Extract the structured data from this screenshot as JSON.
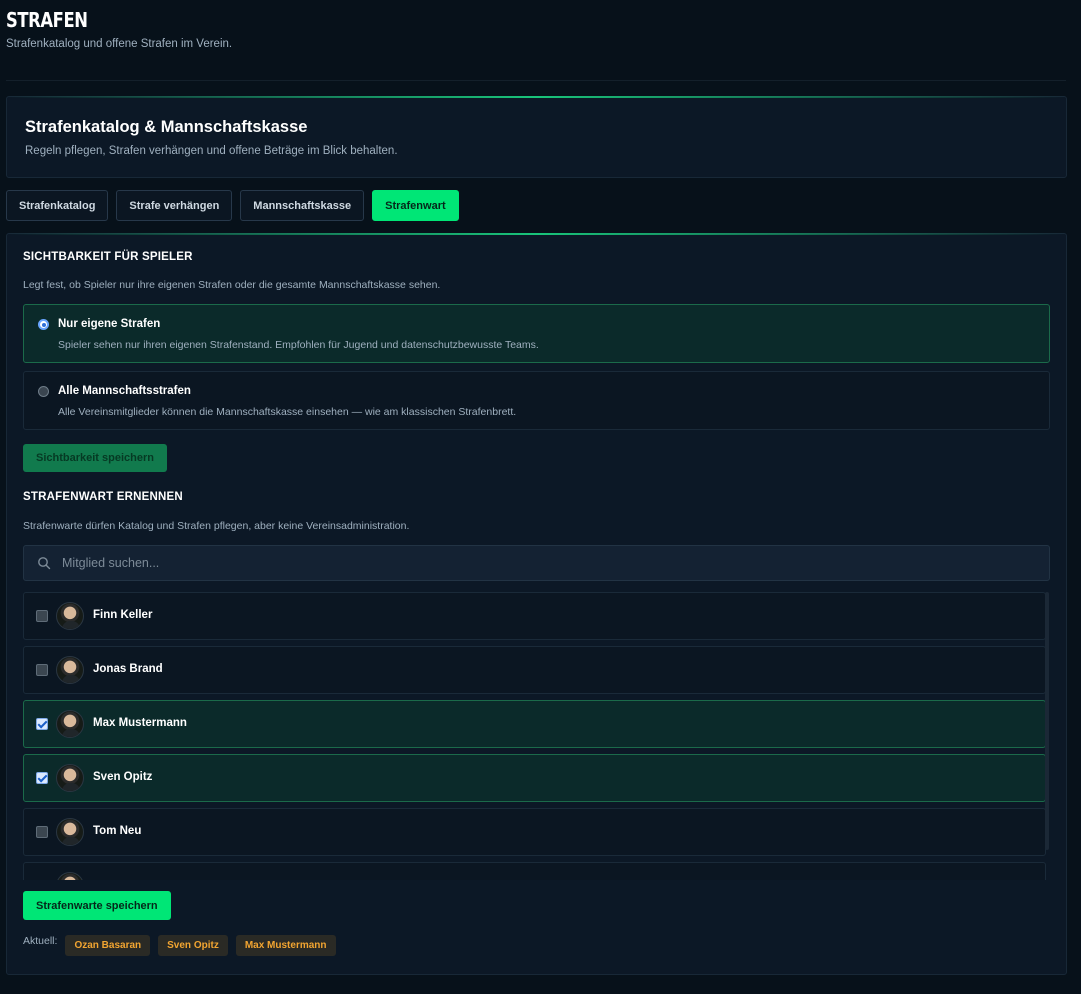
{
  "page": {
    "title": "STRAFEN",
    "subtitle": "Strafenkatalog und offene Strafen im Verein."
  },
  "hero": {
    "title": "Strafenkatalog & Mannschaftskasse",
    "description": "Regeln pflegen, Strafen verhängen und offene Beträge im Blick behalten."
  },
  "tabs": [
    {
      "label": "Strafenkatalog",
      "active": false
    },
    {
      "label": "Strafe verhängen",
      "active": false
    },
    {
      "label": "Mannschaftskasse",
      "active": false
    },
    {
      "label": "Strafenwart",
      "active": true
    }
  ],
  "visibility": {
    "title": "SICHTBARKEIT FÜR SPIELER",
    "description": "Legt fest, ob Spieler nur ihre eigenen Strafen oder die gesamte Mannschaftskasse sehen.",
    "options": [
      {
        "label": "Nur eigene Strafen",
        "description": "Spieler sehen nur ihren eigenen Strafenstand. Empfohlen für Jugend und datenschutzbewusste Teams.",
        "selected": true
      },
      {
        "label": "Alle Mannschaftsstrafen",
        "description": "Alle Vereinsmitglieder können die Mannschaftskasse einsehen — wie am klassischen Strafenbrett.",
        "selected": false
      }
    ],
    "save_label": "Sichtbarkeit speichern"
  },
  "appoint": {
    "title": "STRAFENWART ERNENNEN",
    "description": "Strafenwarte dürfen Katalog und Strafen pflegen, aber keine Vereinsadministration.",
    "search_placeholder": "Mitglied suchen...",
    "members": [
      {
        "name": "Finn Keller",
        "checked": false
      },
      {
        "name": "Jonas Brand",
        "checked": false
      },
      {
        "name": "Max Mustermann",
        "checked": true
      },
      {
        "name": "Sven Opitz",
        "checked": true
      },
      {
        "name": "Tom Neu",
        "checked": false
      },
      {
        "name": "",
        "checked": false
      }
    ],
    "save_label": "Strafenwarte speichern",
    "current_label": "Aktuell:",
    "current": [
      "Ozan Basaran",
      "Sven Opitz",
      "Max Mustermann"
    ]
  },
  "colors": {
    "accent": "#00e676",
    "background": "#07111a",
    "panel": "#0c1826",
    "chip_text": "#f2a531"
  },
  "icons": {
    "search": "search-icon",
    "avatar": "avatar"
  }
}
